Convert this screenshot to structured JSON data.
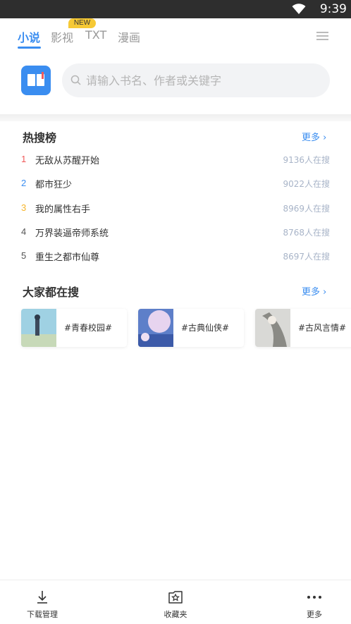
{
  "status_bar": {
    "time": "9:39"
  },
  "tabs": [
    {
      "label": "小说",
      "active": true
    },
    {
      "label": "影视",
      "badge": "NEW"
    },
    {
      "label": "TXT"
    },
    {
      "label": "漫画"
    }
  ],
  "search": {
    "placeholder": "请输入书名、作者或关键字"
  },
  "hot_list": {
    "title": "热搜榜",
    "more": "更多 ›",
    "items": [
      {
        "rank": "1",
        "title": "无敌从苏醒开始",
        "count": "9136人在搜",
        "rank_color": "#f05a5a"
      },
      {
        "rank": "2",
        "title": "都市狂少",
        "count": "9022人在搜",
        "rank_color": "#3a8df0"
      },
      {
        "rank": "3",
        "title": "我的属性右手",
        "count": "8969人在搜",
        "rank_color": "#f6b52a"
      },
      {
        "rank": "4",
        "title": "万界装逼帝师系统",
        "count": "8768人在搜",
        "rank_color": "#555555"
      },
      {
        "rank": "5",
        "title": "重生之都市仙尊",
        "count": "8697人在搜",
        "rank_color": "#555555"
      }
    ]
  },
  "popular": {
    "title": "大家都在搜",
    "more": "更多 ›",
    "tags": [
      {
        "label": "#青春校园#"
      },
      {
        "label": "#古典仙侠#"
      },
      {
        "label": "#古风言情#"
      }
    ]
  },
  "bottom_nav": [
    {
      "label": "下载管理",
      "icon": "download-icon"
    },
    {
      "label": "收藏夹",
      "icon": "favorites-icon"
    },
    {
      "label": "更多",
      "icon": "more-dots-icon"
    }
  ],
  "colors": {
    "accent": "#3a8df0",
    "badge": "#f6c935"
  }
}
